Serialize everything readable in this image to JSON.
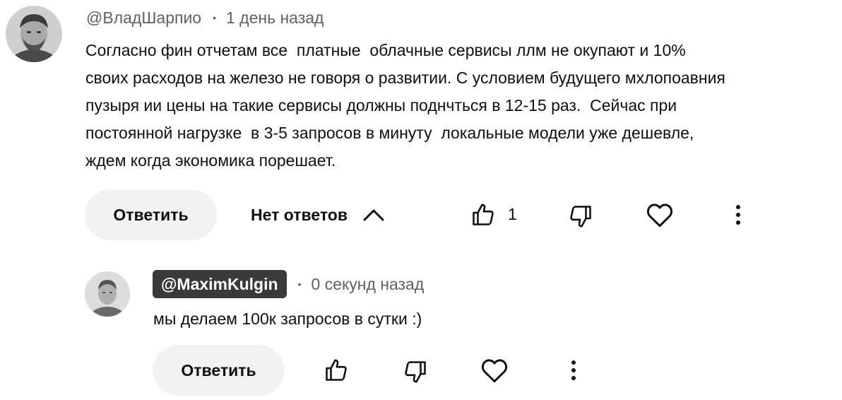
{
  "comment": {
    "author": "@ВладШарпио",
    "separator": "•",
    "time": "1 день назад",
    "text": "Согласно фин отчетам все  платные  облачные сервисы ллм не окупают и 10%\nсвоих расходов на железо не говоря о развитии. С условием будущего мхлопоавния\nпузыря ии цены на такие сервисы должны поднчться в 12-15 раз.  Сейчас при\nпостоянной нагрузке  в 3-5 запросов в минуту  локальные модели уже дешевле,\nждем когда экономика порешает.",
    "reply_label": "Ответить",
    "replies_label": "Нет ответов",
    "like_count": "1"
  },
  "reply": {
    "author": "@MaximKulgin",
    "separator": "•",
    "time": "0 секунд назад",
    "text": "мы делаем 100к запросов в сутки :)",
    "reply_label": "Ответить"
  },
  "icons": {
    "like": "thumb-up-icon",
    "dislike": "thumb-down-icon",
    "heart": "heart-icon",
    "more": "more-vertical-icon",
    "collapse": "chevron-up-icon"
  }
}
